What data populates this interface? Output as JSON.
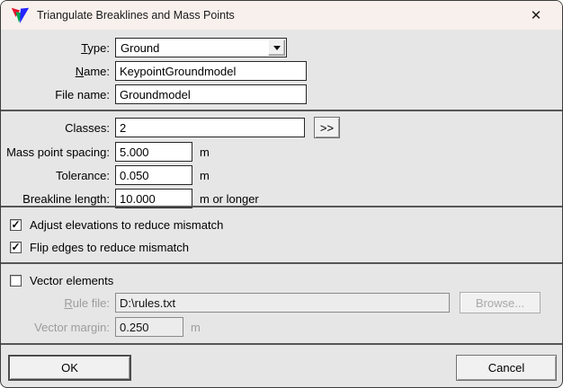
{
  "window": {
    "title": "Triangulate Breaklines and Mass Points",
    "close_glyph": "✕"
  },
  "glyphs": {
    "check": "✓"
  },
  "colors": {
    "titlebar_bg": "#f8f0ec",
    "body_bg": "#e6e6e6",
    "separator": "#565656",
    "icon_red": "#e8112d",
    "icon_green": "#00a651",
    "icon_blue": "#2424ff"
  },
  "form": {
    "type": {
      "accel": "T",
      "label_rest": "ype:",
      "value": "Ground"
    },
    "name": {
      "accel": "N",
      "label_rest": "ame:",
      "value": "KeypointGroundmodel"
    },
    "file_name": {
      "label": "File name:",
      "value": "Groundmodel"
    },
    "classes": {
      "label": "Classes:",
      "value": "2",
      "expand_button": ">>"
    },
    "mass_point_spacing": {
      "label": "Mass point spacing:",
      "value": "5.000",
      "unit": "m"
    },
    "tolerance": {
      "label": "Tolerance:",
      "value": "0.050",
      "unit": "m"
    },
    "breakline_length": {
      "label": "Breakline length:",
      "value": "10.000",
      "unit": "m or longer"
    },
    "adjust_elevations": {
      "label": "Adjust elevations to reduce mismatch",
      "checked": true
    },
    "flip_edges": {
      "label": "Flip edges to reduce mismatch",
      "checked": true
    },
    "vector_elements": {
      "label": "Vector elements",
      "checked": false
    },
    "rule_file": {
      "accel": "R",
      "label_rest": "ule file:",
      "value": "D:\\rules.txt"
    },
    "browse_button_label": "Browse...",
    "vector_margin": {
      "label": "Vector margin:",
      "value": "0.250",
      "unit": "m"
    }
  },
  "footer": {
    "ok_label": "OK",
    "cancel_label": "Cancel"
  }
}
